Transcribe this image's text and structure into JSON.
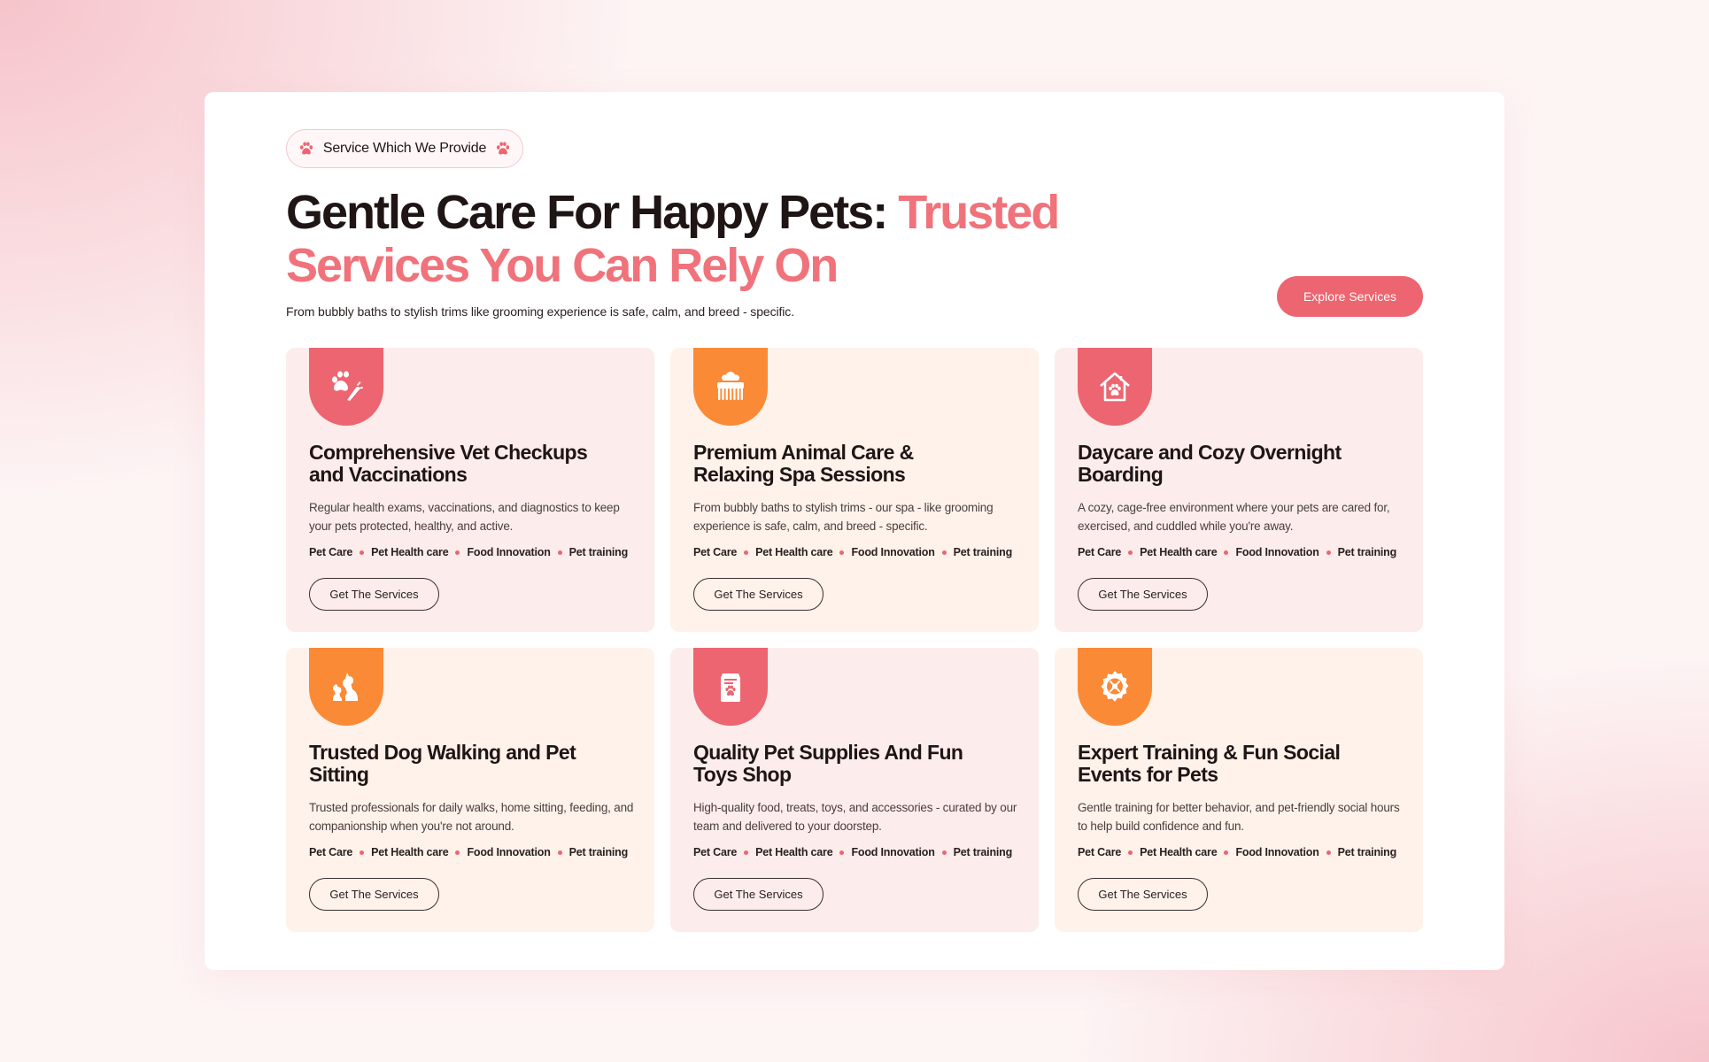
{
  "header": {
    "badge_label": "Service Which We Provide",
    "headline_dark": "Gentle Care For Happy Pets: ",
    "headline_accent": "Trusted Services You Can Rely On",
    "subtitle": "From bubbly baths to stylish trims like grooming experience is safe, calm, and breed - specific.",
    "explore_button": "Explore Services"
  },
  "colors": {
    "accent_red": "#ec6570",
    "accent_orange": "#fb8a36",
    "card_pink": "#fdecec",
    "card_peach": "#fef2ea"
  },
  "cards": [
    {
      "icon": "paw-carrot-icon",
      "title": "Comprehensive Vet Checkups and Vaccinations",
      "description": "Regular health exams, vaccinations, and diagnostics to keep your pets protected, healthy, and active.",
      "tags": [
        "Pet Care",
        "Pet Health care",
        "Food Innovation",
        "Pet training"
      ],
      "button": "Get The Services"
    },
    {
      "icon": "grooming-comb-icon",
      "title": "Premium Animal Care & Relaxing Spa Sessions",
      "description": "From bubbly baths to stylish trims - our spa - like grooming experience is safe, calm, and breed - specific.",
      "tags": [
        "Pet Care",
        "Pet Health care",
        "Food Innovation",
        "Pet training"
      ],
      "button": "Get The Services"
    },
    {
      "icon": "pet-house-icon",
      "title": "Daycare and Cozy Overnight Boarding",
      "description": "A cozy, cage-free environment where your pets are cared for, exercised, and cuddled while you're away.",
      "tags": [
        "Pet Care",
        "Pet Health care",
        "Food Innovation",
        "Pet training"
      ],
      "button": "Get The Services"
    },
    {
      "icon": "dog-cat-icon",
      "title": "Trusted Dog Walking and Pet Sitting",
      "description": "Trusted professionals for daily walks, home sitting, feeding, and companionship when you're not around.",
      "tags": [
        "Pet Care",
        "Pet Health care",
        "Food Innovation",
        "Pet training"
      ],
      "button": "Get The Services"
    },
    {
      "icon": "pet-food-bag-icon",
      "title": "Quality Pet Supplies And Fun Toys Shop",
      "description": "High-quality food, treats, toys, and accessories - curated by our team and delivered to your doorstep.",
      "tags": [
        "Pet Care",
        "Pet Health care",
        "Food Innovation",
        "Pet training"
      ],
      "button": "Get The Services"
    },
    {
      "icon": "training-badge-icon",
      "title": "Expert Training & Fun Social Events for Pets",
      "description": "Gentle training for better behavior, and pet-friendly social hours to help build confidence and fun.",
      "tags": [
        "Pet Care",
        "Pet Health care",
        "Food Innovation",
        "Pet training"
      ],
      "button": "Get The Services"
    }
  ]
}
